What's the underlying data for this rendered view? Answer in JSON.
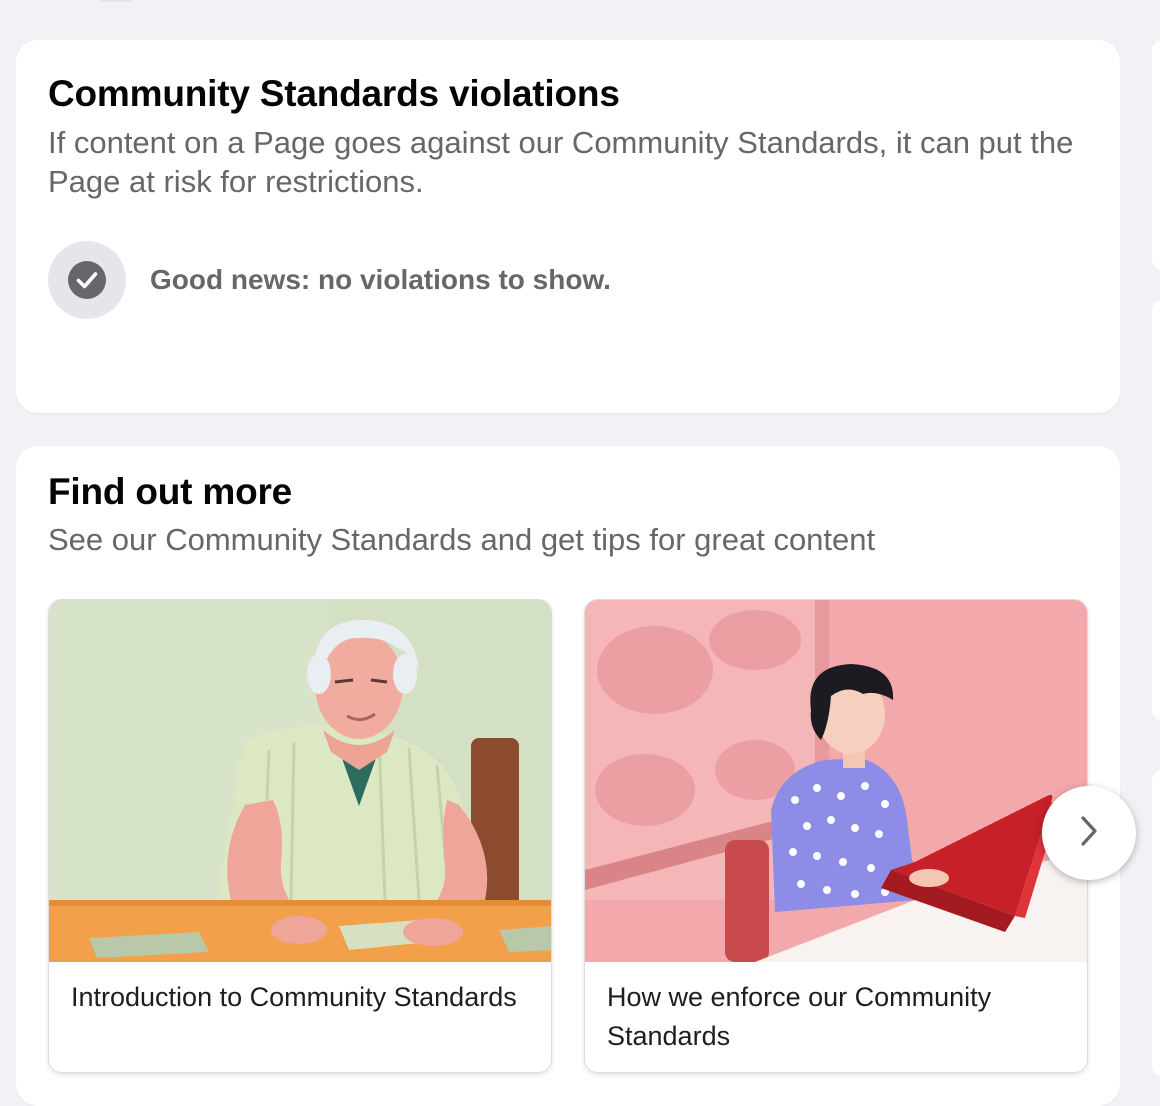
{
  "violations": {
    "title": "Community Standards violations",
    "description": "If content on a Page goes against our Community Standards, it can put the Page at risk for restrictions.",
    "status_icon": "checkmark-circle-icon",
    "status_text": "Good news: no violations to show."
  },
  "find_out_more": {
    "title": "Find out more",
    "subtitle": "See our Community Standards and get tips for great content",
    "resources": [
      {
        "label": "Introduction to Community Standards"
      },
      {
        "label": "How we enforce our Community Standards"
      }
    ],
    "next_icon": "chevron-right-icon"
  },
  "colors": {
    "page_background": "#f0f2f5",
    "card_background": "#ffffff",
    "title_text": "#050505",
    "secondary_text": "#65676b",
    "icon_background": "#e4e6eb",
    "icon_foreground": "#65676b"
  }
}
